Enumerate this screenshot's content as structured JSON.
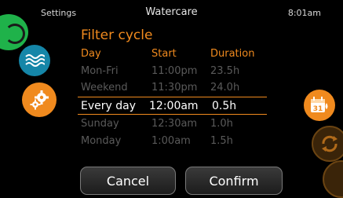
{
  "header": {
    "left": "Settings",
    "title": "Watercare",
    "time": "8:01am"
  },
  "page": {
    "title": "Filter cycle"
  },
  "columns": {
    "day": "Day",
    "start": "Start",
    "duration": "Duration"
  },
  "rows": [
    {
      "day": "Mon-Fri",
      "start": "11:00pm",
      "duration": "23.5h",
      "state": "dim"
    },
    {
      "day": "Weekend",
      "start": "11:30pm",
      "duration": "24.0h",
      "state": "dim"
    },
    {
      "day": "Every day",
      "start": "12:00am",
      "duration": "0.5h",
      "state": "selected"
    },
    {
      "day": "Sunday",
      "start": "12:30am",
      "duration": "1.0h",
      "state": "dim"
    },
    {
      "day": "Monday",
      "start": "1:00am",
      "duration": "1.5h",
      "state": "dim"
    }
  ],
  "buttons": {
    "cancel": "Cancel",
    "confirm": "Confirm"
  },
  "icons": {
    "left": [
      "power-icon",
      "water-waves-icon",
      "settings-gears-icon"
    ],
    "right": [
      "calendar-day-icon",
      "cycle-icon",
      "partial-round-icon"
    ]
  },
  "calendar_day": "31",
  "colors": {
    "accent": "#f08a1e",
    "green": "#1fb24a",
    "teal": "#1586a8"
  }
}
